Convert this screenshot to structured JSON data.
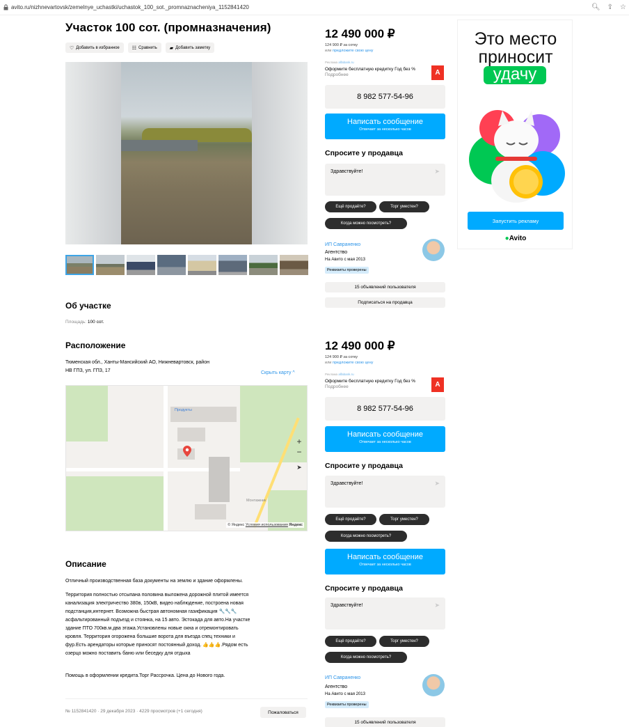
{
  "browser": {
    "url": "avito.ru/nizhnevartovsk/zemelnye_uchastki/uchastok_100_sot._promnaznacheniya_1152841420"
  },
  "listing": {
    "title": "Участок 100 сот. (промназначения)",
    "actions": {
      "favorite": "Добавить в избранное",
      "compare": "Сравнить",
      "note": "Добавить заметку"
    }
  },
  "about": {
    "heading": "Об участке",
    "area_label": "Площадь:",
    "area_value": "100 сот."
  },
  "location": {
    "heading": "Расположение",
    "address_line1": "Тюменская обл., Ханты-Мансийский АО, Нижневартовск, район",
    "address_line2": "НВ ГПЗ, ул. ГПЗ, 17",
    "hide_map": "Скрыть карту ^",
    "map": {
      "zoom_in": "+",
      "zoom_out": "−",
      "poi_label": "Продукты",
      "street_label": "Монтажник",
      "copyright": "© Яндекс",
      "terms": "Условия использования",
      "brand": "Яндекс"
    }
  },
  "description": {
    "heading": "Описание",
    "p1": "Отличный производственная база документы на землю и здание оформлены.",
    "p2_lines": [
      "Территория полностью отсыпана половина выложена дорожной плитой имеется",
      "канализация электричество 380в, 150кВ, видео наблюдение, построена новая",
      "подстанция,интернет. Возможна быстрая автономная газификация 🔧🔧🔧",
      "асфальтированный подъезд и стоянка, на 15 авто. Эстокада для авто.На участке",
      "здание ПТО 700кв.м.два этажа.Установлены новые окна и отремонтировать",
      "кровля. Территория огорожена большие ворота для въезда спец техники и",
      "фур.Есть арендаторы которые приносят постоянный доход. 👍👍👍.Рядом есть",
      "озерцо можно поставить баню или беседку для отдыха"
    ],
    "p3": "Помощь в оформлении кредита.Торг Рассрочка. Цена до Нового года."
  },
  "footer": {
    "meta": "№ 1152841420 · 29 декабря 2023 · 4229 просмотров (+1 сегодня)",
    "complain": "Пожаловаться"
  },
  "sidebar": {
    "price": "12 490 000 ₽",
    "per_unit": "124 900 ₽ за сотку",
    "offer_prefix": "или",
    "offer_link": "предложите свою цену",
    "ad_label": "Реклама",
    "ad_domain": "alfabank.ru",
    "ad_text": "Оформите бесплатную кредитку Год без %",
    "ad_more": "Подробнее",
    "bank_logo": "А",
    "phone": "8 982 577-54-96",
    "message_button": "Написать сообщение",
    "message_sub": "Отвечает за несколько часов",
    "ask_heading": "Спросите у продавца",
    "ask_placeholder": "Здравствуйте!",
    "chips": [
      "Ещё продаёте?",
      "Торг уместен?",
      "Когда можно посмотреть?"
    ],
    "seller_name": "ИП Савраненко",
    "seller_type": "Агентство",
    "seller_since": "На Авито с мая 2013",
    "verified": "Реквизиты проверены",
    "listings_button": "15 объявлений пользователя",
    "subscribe_button": "Подписаться на продавца"
  },
  "banner": {
    "line1": "Это место",
    "line2": "приносит",
    "line3": "удачу",
    "button": "Запустить рекламу",
    "brand": "Avito"
  }
}
